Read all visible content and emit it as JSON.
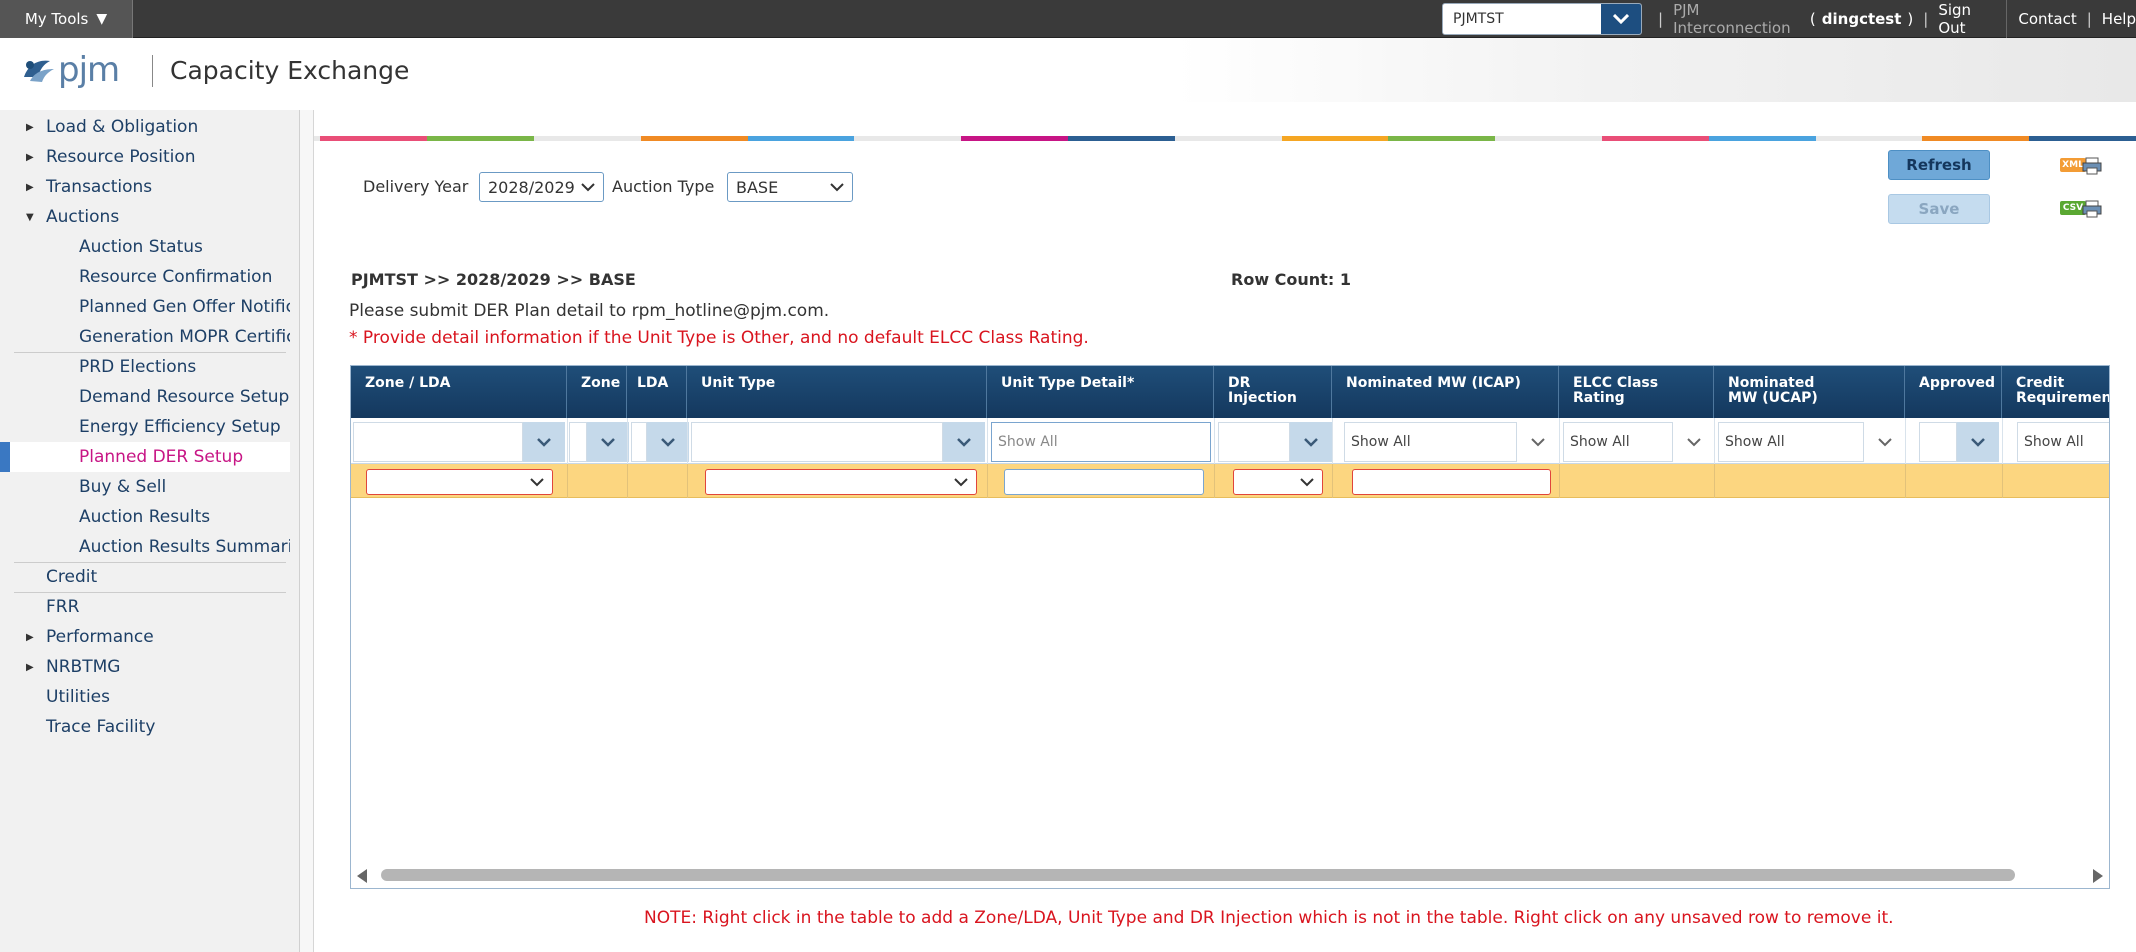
{
  "topbar": {
    "my_tools": "My Tools",
    "environment": "PJMTST",
    "org": "PJM Interconnection",
    "user_open": "(",
    "user": "dingctest",
    "user_close": ")",
    "sign_out": "Sign Out",
    "contact": "Contact",
    "help": "Help"
  },
  "header": {
    "logo_text": "pjm",
    "app_title": "Capacity Exchange"
  },
  "sidebar": {
    "items": [
      {
        "label": "Load & Obligation",
        "expander": "right"
      },
      {
        "label": "Resource Position",
        "expander": "right"
      },
      {
        "label": "Transactions",
        "expander": "right"
      },
      {
        "label": "Auctions",
        "expander": "down"
      },
      {
        "label": "Auction Status"
      },
      {
        "label": "Resource Confirmation"
      },
      {
        "label": "Planned Gen Offer Notification"
      },
      {
        "label": "Generation MOPR Certification"
      },
      {
        "label": "PRD Elections"
      },
      {
        "label": "Demand Resource Setup"
      },
      {
        "label": "Energy Efficiency Setup"
      },
      {
        "label": "Planned DER Setup",
        "active": true
      },
      {
        "label": "Buy & Sell"
      },
      {
        "label": "Auction Results"
      },
      {
        "label": "Auction Results Summaries"
      },
      {
        "label": "Credit"
      },
      {
        "label": "FRR"
      },
      {
        "label": "Performance",
        "expander": "right"
      },
      {
        "label": "NRBTMG",
        "expander": "right"
      },
      {
        "label": "Utilities"
      },
      {
        "label": "Trace Facility"
      }
    ]
  },
  "filters": {
    "delivery_year_label": "Delivery Year",
    "delivery_year_value": "2028/2029",
    "auction_type_label": "Auction Type",
    "auction_type_value": "BASE"
  },
  "actions": {
    "refresh": "Refresh",
    "save": "Save",
    "xml_export": "XML",
    "csv_export": "CSV"
  },
  "context": {
    "breadcrumb": "PJMTST >> 2028/2029 >> BASE",
    "row_count_label": "Row Count:",
    "row_count": "1",
    "hint": "Please submit DER Plan detail to rpm_hotline@pjm.com.",
    "warning": "* Provide detail information if the Unit Type is Other, and no default ELCC Class Rating."
  },
  "grid": {
    "columns": [
      {
        "label": "Zone / LDA"
      },
      {
        "label": "Zone"
      },
      {
        "label": "LDA"
      },
      {
        "label": "Unit Type"
      },
      {
        "label": "Unit Type Detail*"
      },
      {
        "label": "DR Injection"
      },
      {
        "label": "Nominated MW (ICAP)"
      },
      {
        "label": "ELCC Class Rating"
      },
      {
        "label": "Nominated MW (UCAP)"
      },
      {
        "label": "Approved"
      },
      {
        "label": "Credit Requirement"
      }
    ],
    "filter_placeholder": "Show All",
    "filter_show_all": "Show All"
  },
  "footer_note": "NOTE: Right click in the table to add a Zone/LDA, Unit Type and DR Injection which is not in the table. Right click on any unsaved row to remove it.",
  "colors": {
    "nav_active": "#c71585",
    "header_blue": "#1f4e79",
    "row_highlight": "#fcd680",
    "warning_red": "#d9141e"
  }
}
